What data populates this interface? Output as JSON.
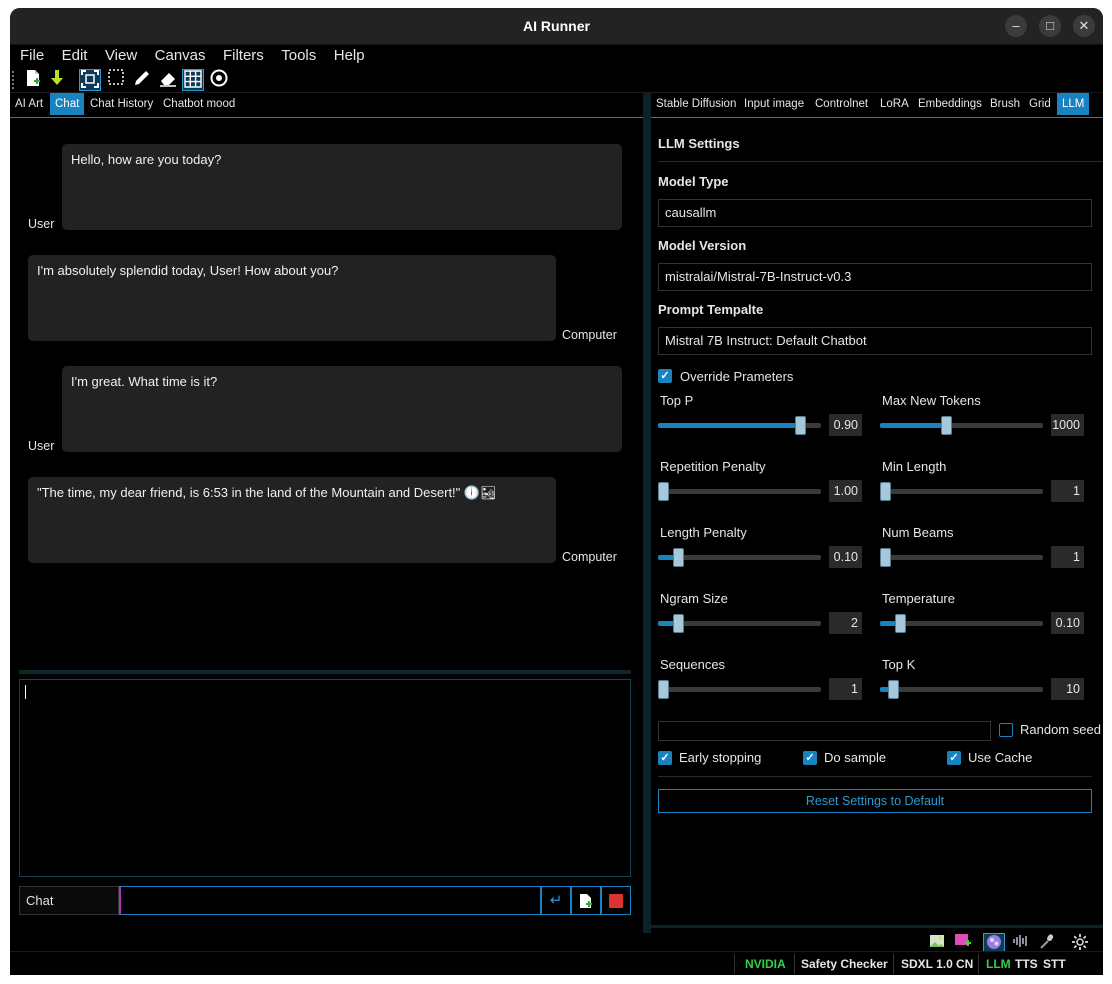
{
  "window": {
    "title": "AI Runner",
    "controls": [
      "–",
      "□",
      "✕"
    ]
  },
  "menu": [
    "File",
    "Edit",
    "View",
    "Canvas",
    "Filters",
    "Tools",
    "Help"
  ],
  "toolbar": {
    "icons": [
      "new-document-icon",
      "download-icon",
      "active-grid-selection-icon",
      "selection-icon",
      "pencil-icon",
      "eraser-icon",
      "grid-icon",
      "target-icon"
    ]
  },
  "left_tabs": [
    "AI Art",
    "Chat",
    "Chat History",
    "Chatbot mood"
  ],
  "messages": [
    {
      "speaker": "User",
      "text": "Hello, how are you today?"
    },
    {
      "speaker": "Computer",
      "text": "I'm absolutely splendid today, User! How about you?"
    },
    {
      "speaker": "User",
      "text": "I'm great. What time is it?"
    },
    {
      "speaker": "Computer",
      "text": "\"The time, my dear friend, is 6:53 in the land of the Mountain and Desert!\" 🕕🏜"
    }
  ],
  "chat_bar": {
    "label": "Chat",
    "input_value": ""
  },
  "right_tabs": [
    "Stable Diffusion",
    "Input image",
    "Controlnet",
    "LoRA",
    "Embeddings",
    "Brush",
    "Grid",
    "LLM"
  ],
  "llm": {
    "heading": "LLM Settings",
    "model_type_label": "Model Type",
    "model_type": "causallm",
    "model_version_label": "Model Version",
    "model_version": "mistralai/Mistral-7B-Instruct-v0.3",
    "prompt_template_label": "Prompt Tempalte",
    "prompt_template": "Mistral 7B Instruct: Default Chatbot",
    "override_label": "Override Prameters",
    "sliders": [
      {
        "label": "Top P",
        "value": "0.90",
        "level": 0.9
      },
      {
        "label": "Max New Tokens",
        "value": "1000",
        "level": 0.4
      },
      {
        "label": "Repetition Penalty",
        "value": "1.00",
        "level": 0.0
      },
      {
        "label": "Min Length",
        "value": "1",
        "level": 0.0
      },
      {
        "label": "Length Penalty",
        "value": "0.10",
        "level": 0.1
      },
      {
        "label": "Num Beams",
        "value": "1",
        "level": 0.0
      },
      {
        "label": "Ngram Size",
        "value": "2",
        "level": 0.1
      },
      {
        "label": "Temperature",
        "value": "0.10",
        "level": 0.1
      },
      {
        "label": "Sequences",
        "value": "1",
        "level": 0.0
      },
      {
        "label": "Top K",
        "value": "10",
        "level": 0.05
      }
    ],
    "random_seed_label": "Random seed",
    "early_stopping_label": "Early stopping",
    "do_sample_label": "Do sample",
    "use_cache_label": "Use Cache",
    "reset_label": "Reset Settings to Default"
  },
  "statusbar": {
    "nvidia": "NVIDIA",
    "safety": "Safety Checker",
    "sdxl": "SDXL 1.0",
    "cn": "CN",
    "llm": "LLM",
    "tts": "TTS",
    "stt": "STT"
  },
  "colors": {
    "accent": "#1883c0",
    "green": "#35d04a"
  }
}
